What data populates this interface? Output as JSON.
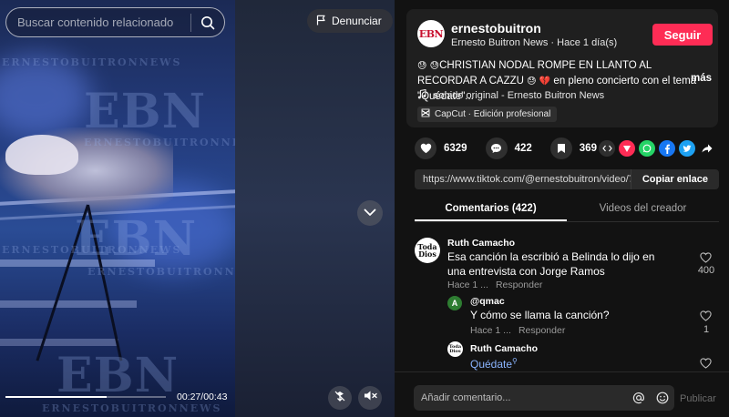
{
  "search": {
    "placeholder": "Buscar contenido relacionado"
  },
  "video": {
    "report_label": "Denunciar",
    "time": "00:27/00:43",
    "progress": 0.63,
    "watermark_big": "EBN",
    "watermark_small": "ERNESTOBUITRONNEWS"
  },
  "post": {
    "username": "ernestobuitron",
    "subtitle": "Ernesto Buitron News · Hace 1 día(s)",
    "follow_label": "Seguir",
    "description": "CHRISTIAN NODAL ROMPE EN LLANTO AL RECORDAR A CAZZU",
    "description_tail": " en pleno concierto con el tema \"Quédate\"...",
    "more_label": "más",
    "sound": "sonido original - Ernesto Buitron News",
    "capcut": "CapCut · Edición profesional",
    "avatar_text": "EBN"
  },
  "stats": {
    "likes": "6329",
    "comments": "422",
    "saves": "369"
  },
  "share_link": {
    "url": "https://www.tiktok.com/@ernestobuitron/video/73...",
    "copy_label": "Copiar enlace"
  },
  "tabs": {
    "comments": "Comentarios (422)",
    "creator_videos": "Videos del creador"
  },
  "comments": [
    {
      "name": "Ruth Camacho",
      "avatar_text": "Toda Dios",
      "text": "Esa canción la escribió a Belinda lo dijo en una entrevista con Jorge Ramos",
      "time": "Hace 1 ...",
      "reply_label": "Responder",
      "likes": "400"
    },
    {
      "name": "@qmac",
      "avatar_letter": "A",
      "avatar_color": "#2e7d32",
      "text": "Y cómo se llama la canción?",
      "time": "Hace 1 ...",
      "reply_label": "Responder",
      "likes": "1"
    },
    {
      "name": "Ruth Camacho",
      "avatar_text": "Toda Dios",
      "text": "Quédate"
    }
  ],
  "composer": {
    "placeholder": "Añadir comentario...",
    "publish_label": "Publicar"
  },
  "colors": {
    "accent": "#fe2c55",
    "panel": "#121212",
    "card": "#1f1f1f"
  }
}
